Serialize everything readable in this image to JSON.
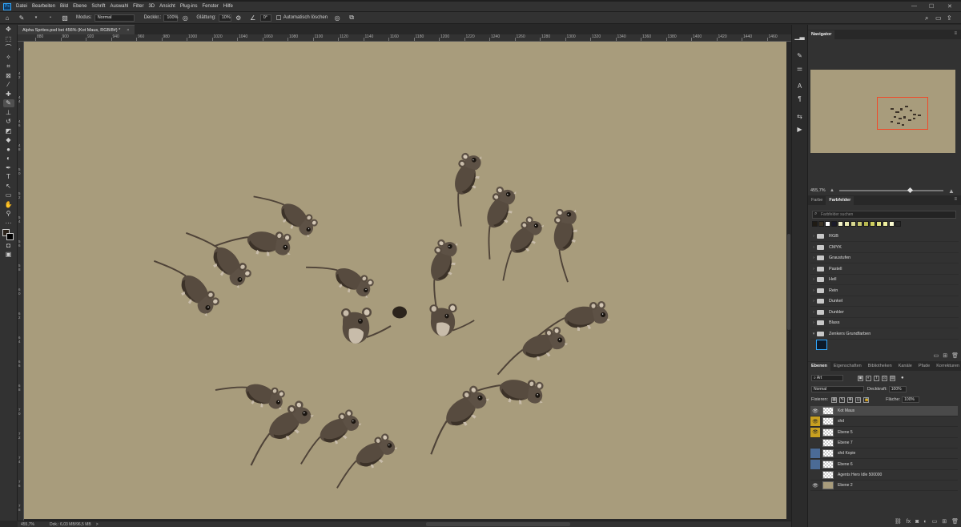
{
  "menu": {
    "app_icon": "Ps",
    "items": [
      "Datei",
      "Bearbeiten",
      "Bild",
      "Ebene",
      "Schrift",
      "Auswahl",
      "Filter",
      "3D",
      "Ansicht",
      "Plug-ins",
      "Fenster",
      "Hilfe"
    ]
  },
  "options": {
    "mode_label": "Modus:",
    "mode_value": "Normal",
    "opacity_label": "Deckkr.:",
    "opacity_value": "100%",
    "smoothing_label": "Glättung:",
    "smoothing_value": "10%",
    "angle_value": "0°",
    "auto_erase_label": "Automatisch löschen"
  },
  "document": {
    "tab_title": "Alpha Sprites.psd bei 456% (Kot Maus, RGB/8#) *",
    "close": "×"
  },
  "ruler_top": [
    "880",
    "900",
    "920",
    "940",
    "960",
    "980",
    "1000",
    "1020",
    "1040",
    "1060",
    "1080",
    "1100",
    "1120",
    "1140",
    "1160",
    "1180",
    "1200",
    "1220",
    "1240",
    "1260",
    "1280",
    "1300",
    "1320",
    "1340",
    "1360",
    "1380",
    "1400",
    "1420",
    "1440",
    "1460",
    "1480"
  ],
  "ruler_left": [
    "4",
    "4 2",
    "4 4",
    "4 6",
    "4 8",
    "5 0",
    "5 2",
    "5 4",
    "5 6",
    "5 8",
    "6 0",
    "6 2",
    "6 4",
    "6 6",
    "6 8",
    "7 0",
    "7 2",
    "7 4",
    "7 6",
    "7 8"
  ],
  "status": {
    "zoom": "455,7%",
    "doc": "Dok.: 6,03 MB/96,5 MB",
    "arrow": ">"
  },
  "navigator": {
    "tab": "Navigator",
    "zoom": "455,7%"
  },
  "swatches": {
    "tab_color": "Farbe",
    "tab_swatches": "Farbfelder",
    "search_placeholder": "Farbfelder suchen",
    "recent": [
      "#1f1b14",
      "#3c3426",
      "#ffffff",
      "#1a1a2a",
      "#f2f2c8",
      "#e8e8b0",
      "#d8d890",
      "#c8c870",
      "#b8b850",
      "#d0d060",
      "#e0e080",
      "#f0f0a0",
      "#fafad0",
      "#2a2a2a"
    ],
    "folders": [
      "RGB",
      "CMYK",
      "Graustufen",
      "Pastell",
      "Hell",
      "Rein",
      "Dunkel",
      "Dunkler",
      "Blass",
      "Zenkers Grundfarben"
    ],
    "selected_color": "#0d1a2a"
  },
  "layers": {
    "tabs": [
      "Ebenen",
      "Eigenschaften",
      "Bibliotheken",
      "Kanäle",
      "Pfade",
      "Korrekturen"
    ],
    "filter_label": "Art",
    "blend_mode": "Normal",
    "opacity_label": "Deckkraft:",
    "opacity_value": "100%",
    "lock_label": "Fixieren:",
    "fill_label": "Fläche:",
    "fill_value": "100%",
    "items": [
      {
        "name": "Kot Maus",
        "visible": true,
        "color": "none",
        "selected": true
      },
      {
        "name": "shd",
        "visible": true,
        "color": "yellow",
        "selected": false
      },
      {
        "name": "Ebene 5",
        "visible": true,
        "color": "yellow",
        "selected": false
      },
      {
        "name": "Ebene 7",
        "visible": false,
        "color": "none",
        "selected": false
      },
      {
        "name": "shd Kopie",
        "visible": false,
        "color": "blue",
        "selected": false
      },
      {
        "name": "Ebene 6",
        "visible": false,
        "color": "blue",
        "selected": false
      },
      {
        "name": "Agents Hero Idle 500000",
        "visible": false,
        "color": "none",
        "selected": false
      },
      {
        "name": "Ebene 2",
        "visible": true,
        "color": "none",
        "selected": false
      }
    ]
  },
  "colors": {
    "canvas": "#a89c7c",
    "mouse_dark": "#574b3f",
    "mouse_shadow": "#3c3228",
    "mouse_light": "#c8bcaa",
    "accent_blue": "#31a8ff",
    "nav_frame": "#f04a2a"
  }
}
